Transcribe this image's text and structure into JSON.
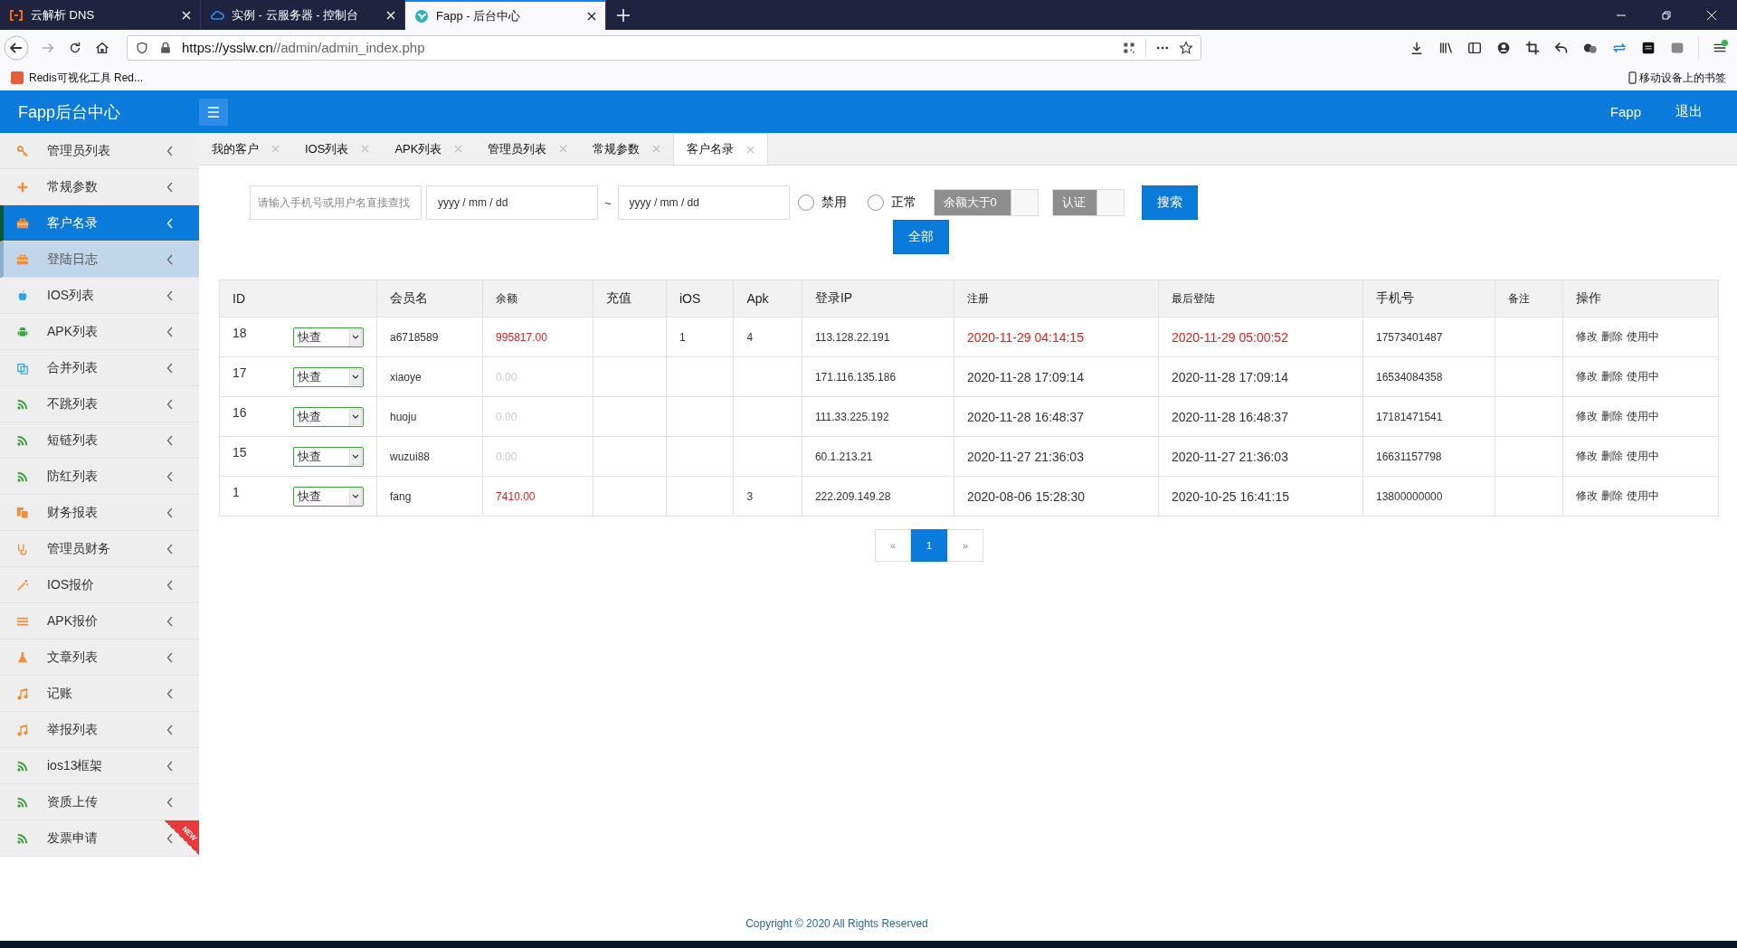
{
  "browser": {
    "tabs": [
      {
        "title": "云解析 DNS",
        "kind": "bracket",
        "selected": false
      },
      {
        "title": "实例 - 云服务器 - 控制台",
        "kind": "cloud",
        "selected": false
      },
      {
        "title": "Fapp - 后台中心",
        "kind": "bird",
        "selected": true
      }
    ],
    "url_host": "https://ysslw.cn",
    "url_path": "//admin/admin_index.php",
    "bookmarks": [
      {
        "label": "Redis可视化工具 Red..."
      }
    ],
    "mobile_bookmarks": "移动设备上的书签"
  },
  "app": {
    "title": "Fapp后台中心",
    "user": "Fapp",
    "logout": "退出"
  },
  "sidebar": {
    "items": [
      {
        "label": "管理员列表",
        "kind": "key",
        "selected": false,
        "hovered": false
      },
      {
        "label": "常规参数",
        "kind": "plus",
        "selected": false,
        "hovered": false
      },
      {
        "label": "客户名录",
        "kind": "briefcase",
        "selected": true,
        "hovered": false
      },
      {
        "label": "登陆日志",
        "kind": "briefcase",
        "selected": false,
        "hovered": true
      },
      {
        "label": "IOS列表",
        "kind": "apple",
        "selected": false,
        "hovered": false
      },
      {
        "label": "APK列表",
        "kind": "android",
        "selected": false,
        "hovered": false
      },
      {
        "label": "合并列表",
        "kind": "copy",
        "selected": false,
        "hovered": false
      },
      {
        "label": "不跳列表",
        "kind": "rss",
        "selected": false,
        "hovered": false
      },
      {
        "label": "短链列表",
        "kind": "rss",
        "selected": false,
        "hovered": false
      },
      {
        "label": "防红列表",
        "kind": "rss",
        "selected": false,
        "hovered": false
      },
      {
        "label": "财务报表",
        "kind": "files",
        "selected": false,
        "hovered": false
      },
      {
        "label": "管理员财务",
        "kind": "stethoscope",
        "selected": false,
        "hovered": false
      },
      {
        "label": "IOS报价",
        "kind": "wand",
        "selected": false,
        "hovered": false
      },
      {
        "label": "APK报价",
        "kind": "bars",
        "selected": false,
        "hovered": false
      },
      {
        "label": "文章列表",
        "kind": "flask",
        "selected": false,
        "hovered": false
      },
      {
        "label": "记账",
        "kind": "music",
        "selected": false,
        "hovered": false
      },
      {
        "label": "举报列表",
        "kind": "music",
        "selected": false,
        "hovered": false
      },
      {
        "label": "ios13框架",
        "kind": "rss",
        "selected": false,
        "hovered": false
      },
      {
        "label": "资质上传",
        "kind": "rss",
        "selected": false,
        "hovered": false
      },
      {
        "label": "发票申请",
        "kind": "rss",
        "selected": false,
        "hovered": false,
        "new_ribbon": "NEW"
      }
    ]
  },
  "page_tabs": [
    {
      "label": "我的客户",
      "selected": false
    },
    {
      "label": "IOS列表",
      "selected": false
    },
    {
      "label": "APK列表",
      "selected": false
    },
    {
      "label": "管理员列表",
      "selected": false
    },
    {
      "label": "常规参数",
      "selected": false
    },
    {
      "label": "客户名录",
      "selected": true
    }
  ],
  "filters": {
    "search_placeholder": "请输入手机号或用户名直接查找",
    "date_from": "yyyy / mm / dd",
    "separator": "~",
    "date_to": "yyyy / mm / dd",
    "radios": [
      {
        "label": "禁用",
        "selected": false
      },
      {
        "label": "正常",
        "selected": false
      }
    ],
    "toggles": [
      {
        "label": "余额大于0",
        "on": false
      },
      {
        "label": "认证",
        "on": false
      }
    ],
    "search_button": "搜索",
    "all_button": "全部"
  },
  "table": {
    "columns": [
      "ID",
      "会员名",
      "余额",
      "充值",
      "iOS",
      "Apk",
      "登录IP",
      "注册",
      "最后登陆",
      "手机号",
      "备注",
      "操作"
    ],
    "rows": [
      {
        "id": "18",
        "quick": "快查",
        "name": "a6718589",
        "balance": "995817.00",
        "balance_red": true,
        "recharge": "",
        "ios": "1",
        "apk": "4",
        "ip": "113.128.22.191",
        "registered": "2020-11-29 04:14:15",
        "last_login": "2020-11-29 05:00:52",
        "times_red": true,
        "phone": "17573401487",
        "actions": [
          "修改",
          "删除",
          "使用中"
        ]
      },
      {
        "id": "17",
        "quick": "快查",
        "name": "xiaoye",
        "balance": "0.00",
        "balance_red": false,
        "recharge": "",
        "ios": "",
        "apk": "",
        "ip": "171.116.135.186",
        "registered": "2020-11-28 17:09:14",
        "last_login": "2020-11-28 17:09:14",
        "times_red": false,
        "phone": "16534084358",
        "actions": [
          "修改",
          "删除",
          "使用中"
        ]
      },
      {
        "id": "16",
        "quick": "快查",
        "name": "huoju",
        "balance": "0.00",
        "balance_red": false,
        "recharge": "",
        "ios": "",
        "apk": "",
        "ip": "111.33.225.192",
        "registered": "2020-11-28 16:48:37",
        "last_login": "2020-11-28 16:48:37",
        "times_red": false,
        "phone": "17181471541",
        "actions": [
          "修改",
          "删除",
          "使用中"
        ]
      },
      {
        "id": "15",
        "quick": "快查",
        "name": "wuzui88",
        "balance": "0.00",
        "balance_red": false,
        "recharge": "",
        "ios": "",
        "apk": "",
        "ip": "60.1.213.21",
        "registered": "2020-11-27 21:36:03",
        "last_login": "2020-11-27 21:36:03",
        "times_red": false,
        "phone": "16631157798",
        "actions": [
          "修改",
          "删除",
          "使用中"
        ]
      },
      {
        "id": "1",
        "quick": "快查",
        "name": "fang",
        "balance": "7410.00",
        "balance_red": true,
        "recharge": "",
        "ios": "",
        "apk": "3",
        "ip": "222.209.149.28",
        "registered": "2020-08-06 15:28:30",
        "last_login": "2020-10-25 16:41:15",
        "times_red": false,
        "phone": "13800000000",
        "actions": [
          "修改",
          "删除",
          "使用中"
        ]
      }
    ]
  },
  "pagination": [
    {
      "label": "«",
      "selected": false
    },
    {
      "label": "1",
      "selected": true
    },
    {
      "label": "»",
      "selected": false
    }
  ],
  "footer": "Copyright © 2020 All Rights Reserved"
}
